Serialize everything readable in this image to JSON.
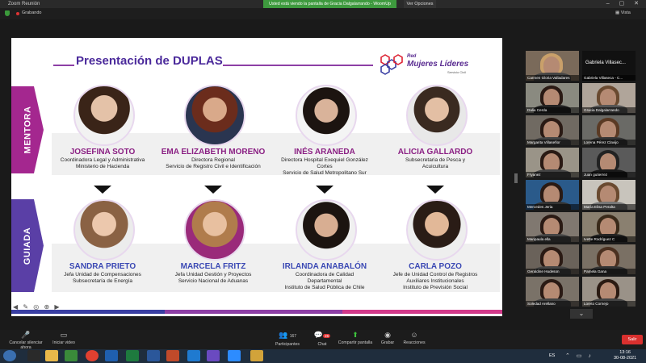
{
  "window": {
    "title": "Zoom Reunión",
    "share_banner": "Usted está viendo la pantalla de Gracia Dalgalarrando - WoomUp",
    "options_label": "Ver Opciones",
    "recording_label": "Grabando",
    "view_label": "Vista"
  },
  "slide": {
    "title": "Presentación de DUPLAS",
    "logo": {
      "line1": "Red",
      "line2": "Mujeres Líderes",
      "sub": "Servicio Civil"
    },
    "mentora_label": "MENTORA",
    "guiada_label": "GUIADA",
    "mentoras": [
      {
        "name": "JOSEFINA SOTO",
        "role1": "Coordinadora Legal y Administrativa",
        "role2": "Ministerio de Hacienda",
        "role3": ""
      },
      {
        "name": "EMA ELIZABETH MORENO",
        "role1": "Directora Regional",
        "role2": "Servicio de Registro Civil e Identificación",
        "role3": ""
      },
      {
        "name": "INÉS ARANEDA",
        "role1": "Directora Hospital Exequiel González",
        "role2": "Cortes",
        "role3": "Servicio de Salud Metropolitano Sur"
      },
      {
        "name": "ALICIA GALLARDO",
        "role1": "Subsecretaria de Pesca y",
        "role2": "Acuicultura",
        "role3": ""
      }
    ],
    "guiadas": [
      {
        "name": "SANDRA PRIETO",
        "role1": "Jefa Unidad de Compensaciones",
        "role2": "Subsecretaría de Energía",
        "role3": ""
      },
      {
        "name": "MARCELA FRITZ",
        "role1": "Jefa Unidad Gestión y Proyectos",
        "role2": "Servicio Nacional de Aduanas",
        "role3": ""
      },
      {
        "name": "IRLANDA ANABALÓN",
        "role1": "Coordinadora de Calidad",
        "role2": "Departamental",
        "role3": "Instituto de Salud Pública de Chile"
      },
      {
        "name": "CARLA POZO",
        "role1": "Jefe de Unidad Control de Registros",
        "role2": "Auxiliares Institucionales",
        "role3": "Instituto de Previsión Social"
      }
    ]
  },
  "gallery": [
    {
      "name": "Carmen Gloria Valladares"
    },
    {
      "name": "Gabriela Villaseca - C..."
    },
    {
      "name": "Dalia Cerda"
    },
    {
      "name": "Gracia Dalgalarrando"
    },
    {
      "name": "Margarita Villaseñor"
    },
    {
      "name": "Lorena Pérez Clavijo"
    },
    {
      "name": "Fryanez"
    },
    {
      "name": "Juan gutierrez"
    },
    {
      "name": "Mercedes Jeria"
    },
    {
      "name": "María Elisa Peralta"
    },
    {
      "name": "Maripaula ella"
    },
    {
      "name": "Ivette Rodríguez C"
    },
    {
      "name": "Geraldine Hudeson"
    },
    {
      "name": "Pamela Gana"
    },
    {
      "name": "Soledad Arellano"
    },
    {
      "name": "Loreto Cornejo"
    }
  ],
  "gallery_header": "Gabriela Villasec...",
  "controls": {
    "mute": "Cancelar silenciar ahora",
    "video": "Iniciar video",
    "participants": "Participantes",
    "participants_count": "167",
    "chat": "Chat",
    "chat_badge": "26",
    "share": "Compartir pantalla",
    "record": "Grabar",
    "reactions": "Reacciones",
    "end": "Salir"
  },
  "taskbar": {
    "lang": "ES",
    "time": "13:16",
    "date": "30-08-2021"
  },
  "colors": {
    "mentora_tab": "#a4278f",
    "guiada_tab": "#5a3fa6",
    "title": "#4b2a9b",
    "mentora_name": "#8a1f83",
    "guiada_name": "#3b49b4"
  }
}
